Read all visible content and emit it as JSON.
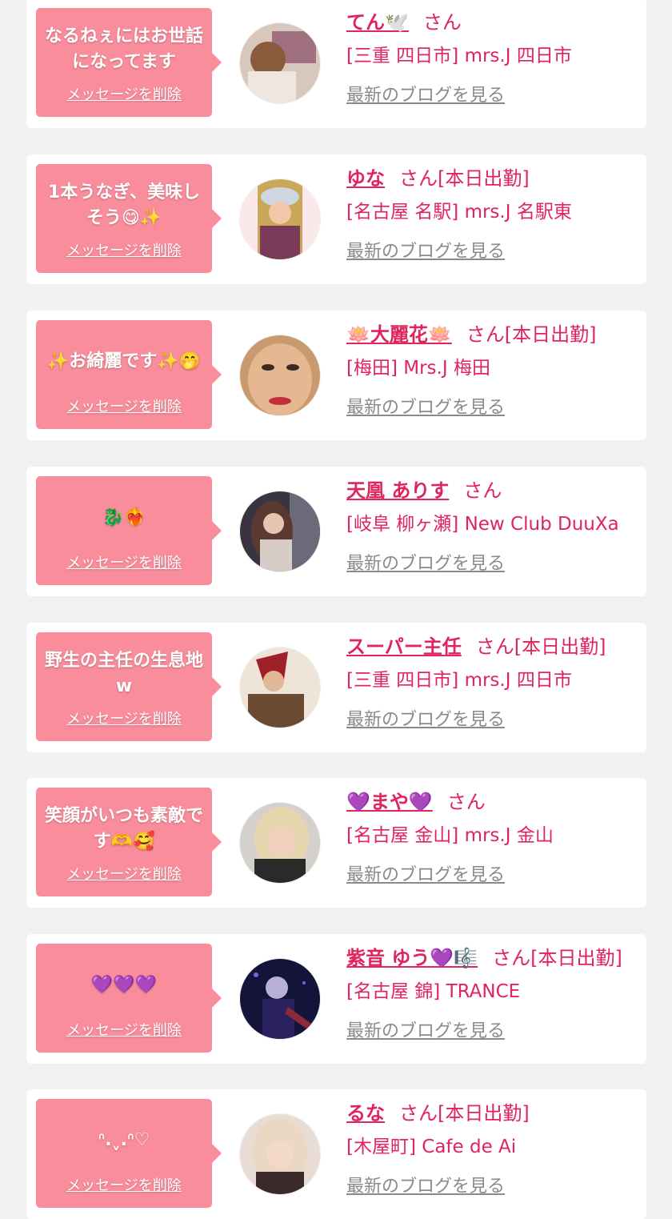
{
  "delete_label": "メッセージを削除",
  "blog_label": "最新のブログを見る",
  "colors": {
    "accent": "#e0245e",
    "bubble": "#f98d9c",
    "card": "#ffffff",
    "background": "#f1f1f1",
    "link_gray": "#8a8a8a"
  },
  "cards": [
    {
      "message": "なるねぇにはお世話になってます",
      "name": "てん🕊️",
      "suffix": "さん",
      "shop": "[三重 四日市] mrs.J 四日市",
      "avatar_icon": "avatar-photo"
    },
    {
      "message": "1本うなぎ、美味しそう😋✨",
      "name": "ゆな",
      "suffix": "さん[本日出勤]",
      "shop": "[名古屋 名駅] mrs.J 名駅東",
      "avatar_icon": "avatar-photo"
    },
    {
      "message": "✨お綺麗です✨🤭",
      "name": "🪷大麗花🪷",
      "suffix": "さん[本日出勤]",
      "shop": "[梅田] Mrs.J 梅田",
      "avatar_icon": "avatar-photo"
    },
    {
      "message": "🐉❤️‍🔥",
      "name": "天凰 ありす",
      "suffix": "さん",
      "shop": "[岐阜 柳ヶ瀬] New Club DuuXa",
      "avatar_icon": "avatar-photo"
    },
    {
      "message": "野生の主任の生息地w",
      "name": "スーパー主任",
      "suffix": "さん[本日出勤]",
      "shop": "[三重 四日市] mrs.J 四日市",
      "avatar_icon": "avatar-photo"
    },
    {
      "message": "笑顔がいつも素敵です🫶🥰",
      "name": "💜まや💜",
      "suffix": "さん",
      "shop": "[名古屋 金山] mrs.J 金山",
      "avatar_icon": "avatar-photo"
    },
    {
      "message": "💜💜💜",
      "name": "紫音 ゆう💜🎼",
      "suffix": "さん[本日出勤]",
      "shop": "[名古屋 錦] TRANCE",
      "avatar_icon": "avatar-photo"
    },
    {
      "message": "ᐢ.ˬ.ᐢ♡",
      "name": "るな",
      "suffix": "さん[本日出勤]",
      "shop": "[木屋町] Cafe de Ai",
      "avatar_icon": "avatar-photo"
    }
  ]
}
